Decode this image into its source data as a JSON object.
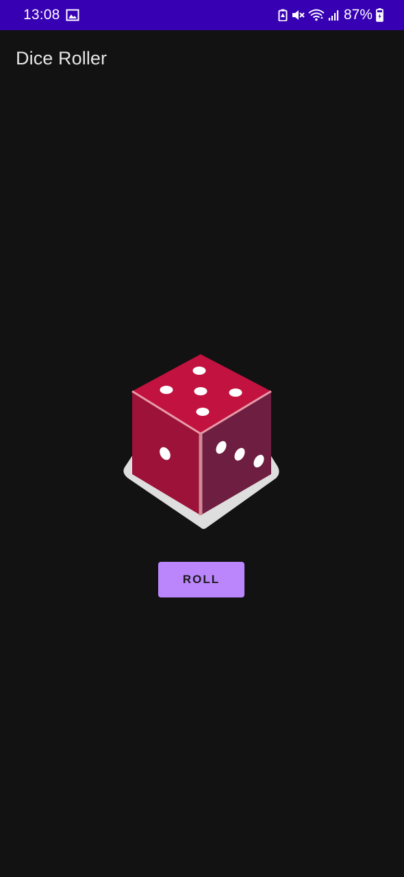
{
  "status_bar": {
    "time": "13:08",
    "battery": "87%",
    "background_color": "#3700b3",
    "icons": [
      "gallery-icon",
      "battery-saver-icon",
      "mute-icon",
      "wifi-icon",
      "signal-icon",
      "battery-charging-icon"
    ]
  },
  "app_bar": {
    "title": "Dice Roller"
  },
  "dice": {
    "icon": "dice-icon",
    "top_face_pips": 5,
    "left_face_pips": 1,
    "right_face_pips": 3,
    "colors": {
      "top": "#c2123f",
      "left": "#9c1238",
      "right": "#6e1e40",
      "shadow": "#dedede"
    }
  },
  "roll_button": {
    "label": "ROLL",
    "color": "#bb86fc"
  }
}
